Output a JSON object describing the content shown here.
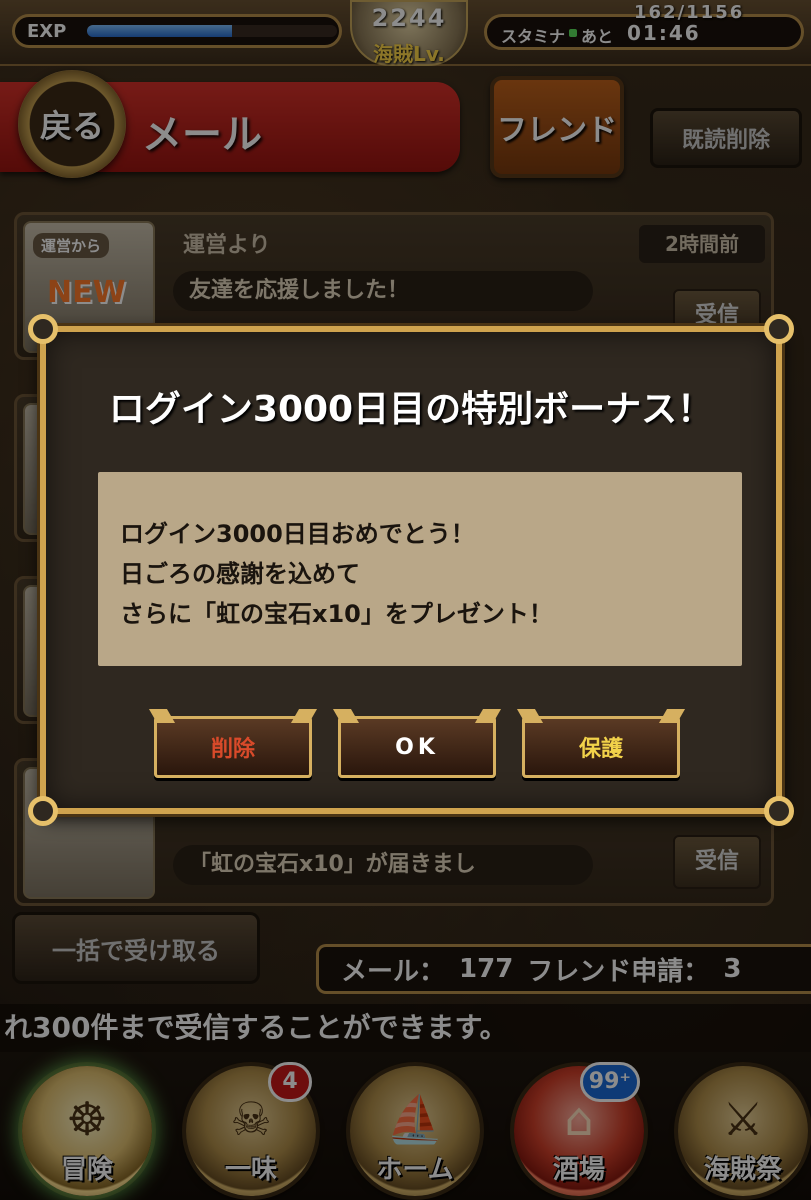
{
  "status": {
    "exp_label": "EXP",
    "exp_progress": 0.58,
    "level": "2244",
    "level_label": "海賊Lv.",
    "stamina_label": "スタミナ",
    "stamina_ato": "あと",
    "stamina_time": "01:46",
    "stamina_count": "162/1156"
  },
  "header": {
    "back_label": "戻る",
    "title": "メール",
    "friend_label": "フレンド",
    "read_delete_label": "既読削除"
  },
  "mail_list": {
    "items": [
      {
        "from_badge": "運営から",
        "new_badge": "NEW",
        "sender": "運営より",
        "time": "2時間前",
        "subject": "友達を応援しました！",
        "receive": "受信"
      },
      {
        "subject": "「虹の宝石x10」が届きまし",
        "receive": "受信"
      }
    ]
  },
  "bottom": {
    "bulk_receive_label": "一括で受け取る",
    "mail_count_label": "メール：",
    "mail_count": "177",
    "friend_request_label": "フレンド申請：",
    "friend_request_count": "3",
    "notice": "れ300件まで受信することができます。"
  },
  "nav": {
    "items": [
      {
        "label": "冒険",
        "icon": "ship-wheel-icon"
      },
      {
        "label": "一味",
        "icon": "jolly-roger-icon",
        "badge": "4"
      },
      {
        "label": "ホーム",
        "icon": "ship-icon"
      },
      {
        "label": "酒場",
        "icon": "saloon-icon",
        "badge": "99⁺"
      },
      {
        "label": "海賊祭",
        "icon": "sword-icon"
      }
    ]
  },
  "dialog": {
    "title": "ログイン3000日目の特別ボーナス！",
    "body_lines": [
      "ログイン3000日目おめでとう！",
      "日ごろの感謝を込めて",
      "さらに「虹の宝石x10」をプレゼント！"
    ],
    "delete_label": "削除",
    "ok_label": "OK",
    "protect_label": "保護"
  },
  "colors": {
    "ribbon_red": "#c8241c",
    "dialog_frame_gold": "#cfa34e",
    "body_parchment": "#b9a788",
    "delete_red": "#d94a2a",
    "protect_yellow": "#f2d24a"
  }
}
